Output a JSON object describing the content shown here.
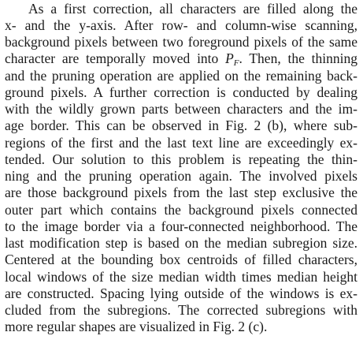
{
  "paragraph": {
    "lines": [
      "As a first correction, all characters are filled along the",
      "x- and the y-axis.  After row- and column-wise scanning,",
      "background pixels between two foreground pixels of the same",
      {
        "before": "character are temporally moved into ",
        "math_base": "P",
        "math_sub": "F",
        "after": ".  Then, the thinning"
      },
      "and the pruning operation are applied on the remaining back-",
      "ground pixels.  A further correction is conducted by dealing",
      "with the wildly grown parts between characters and the im-",
      "age border.  This can be observed in Fig. 2 (b), where sub-",
      "regions of the first and the last text line are exceedingly ex-",
      "tended.  Our solution to this problem is repeating the thin-",
      "ning and the pruning operation again.  The involved pixels",
      "are those background pixels from the last step exclusive the",
      "outer part which contains the background pixels connected",
      "to the image border via a four-connected neighborhood.  The",
      "last modification step is based on the median subregion size.",
      "Centered at the bounding box centroids of filled characters,",
      "local windows of the size median width times median height",
      "are constructed.  Spacing lying outside of the windows is ex-",
      "cluded from the subregions.  The corrected subregions with",
      "more regular shapes are visualized in Fig. 2 (c)."
    ]
  }
}
